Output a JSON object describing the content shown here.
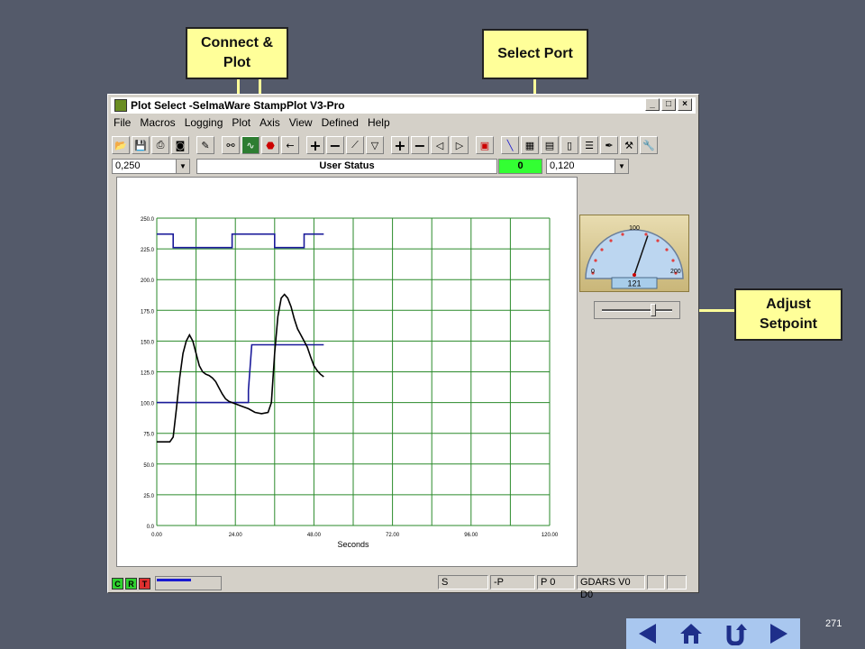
{
  "callouts": {
    "connect_plot": "Connect &\nPlot",
    "select_port": "Select Port",
    "adjust_setpoint": "Adjust\nSetpoint"
  },
  "window": {
    "title": "Plot Select -SelmaWare StampPlot V3-Pro",
    "menu": [
      "File",
      "Macros",
      "Logging",
      "Plot",
      "Axis",
      "View",
      "Defined",
      "Help"
    ],
    "combo_left": "0,250",
    "user_status": "User Status",
    "value_display": "0",
    "combo_right": "0,120",
    "status_indicators": [
      "C",
      "R",
      "T"
    ],
    "status_cells": [
      "S",
      "-P",
      "P 0",
      "GDARS V0 D0"
    ],
    "colors": {
      "value_box": "#33ff33",
      "indicator_green": "#2fd12f",
      "indicator_red": "#e03030"
    }
  },
  "gauge": {
    "label_top": "100",
    "label_min": "0",
    "label_max": "200",
    "readout": "121"
  },
  "chart_data": {
    "type": "line",
    "xlabel": "Seconds",
    "ylabel": "",
    "xlim": [
      0,
      120
    ],
    "ylim": [
      0,
      250
    ],
    "x_ticks": [
      "0.00",
      "24.00",
      "48.00",
      "72.00",
      "96.00",
      "120.00"
    ],
    "y_ticks": [
      "0.0",
      "25.0",
      "50.0",
      "75.0",
      "100.0",
      "125.0",
      "150.0",
      "175.0",
      "200.0",
      "225.0",
      "250.0"
    ],
    "grid": true,
    "series": [
      {
        "color": "#1a1a9a",
        "points": [
          [
            0,
            237
          ],
          [
            5,
            237
          ],
          [
            5,
            226
          ],
          [
            23,
            226
          ],
          [
            23,
            237
          ],
          [
            36,
            237
          ],
          [
            36,
            226
          ],
          [
            45,
            226
          ],
          [
            45,
            237
          ],
          [
            51,
            237
          ]
        ]
      },
      {
        "color": "#1a1a9a",
        "points": [
          [
            0,
            100
          ],
          [
            28,
            100
          ],
          [
            28,
            110
          ],
          [
            29,
            147
          ],
          [
            51,
            147
          ]
        ]
      },
      {
        "color": "#000000",
        "points": [
          [
            0,
            68
          ],
          [
            4,
            68
          ],
          [
            5,
            72
          ],
          [
            6,
            95
          ],
          [
            7,
            120
          ],
          [
            8,
            140
          ],
          [
            9,
            150
          ],
          [
            10,
            155
          ],
          [
            11,
            150
          ],
          [
            12,
            140
          ],
          [
            13,
            130
          ],
          [
            14,
            125
          ],
          [
            15,
            123
          ],
          [
            16,
            122
          ],
          [
            17,
            120
          ],
          [
            18,
            117
          ],
          [
            19,
            112
          ],
          [
            20,
            107
          ],
          [
            21,
            103
          ],
          [
            22,
            101
          ],
          [
            24,
            99
          ],
          [
            26,
            97
          ],
          [
            28,
            95
          ],
          [
            30,
            92
          ],
          [
            32,
            91
          ],
          [
            34,
            92
          ],
          [
            35,
            100
          ],
          [
            36,
            140
          ],
          [
            37,
            170
          ],
          [
            38,
            185
          ],
          [
            39,
            188
          ],
          [
            40,
            185
          ],
          [
            41,
            178
          ],
          [
            42,
            168
          ],
          [
            43,
            160
          ],
          [
            44,
            155
          ],
          [
            45,
            150
          ],
          [
            46,
            145
          ],
          [
            47,
            137
          ],
          [
            48,
            130
          ],
          [
            49,
            126
          ],
          [
            50,
            123
          ],
          [
            51,
            121
          ]
        ]
      }
    ]
  },
  "nav": {
    "page_number": "271"
  }
}
